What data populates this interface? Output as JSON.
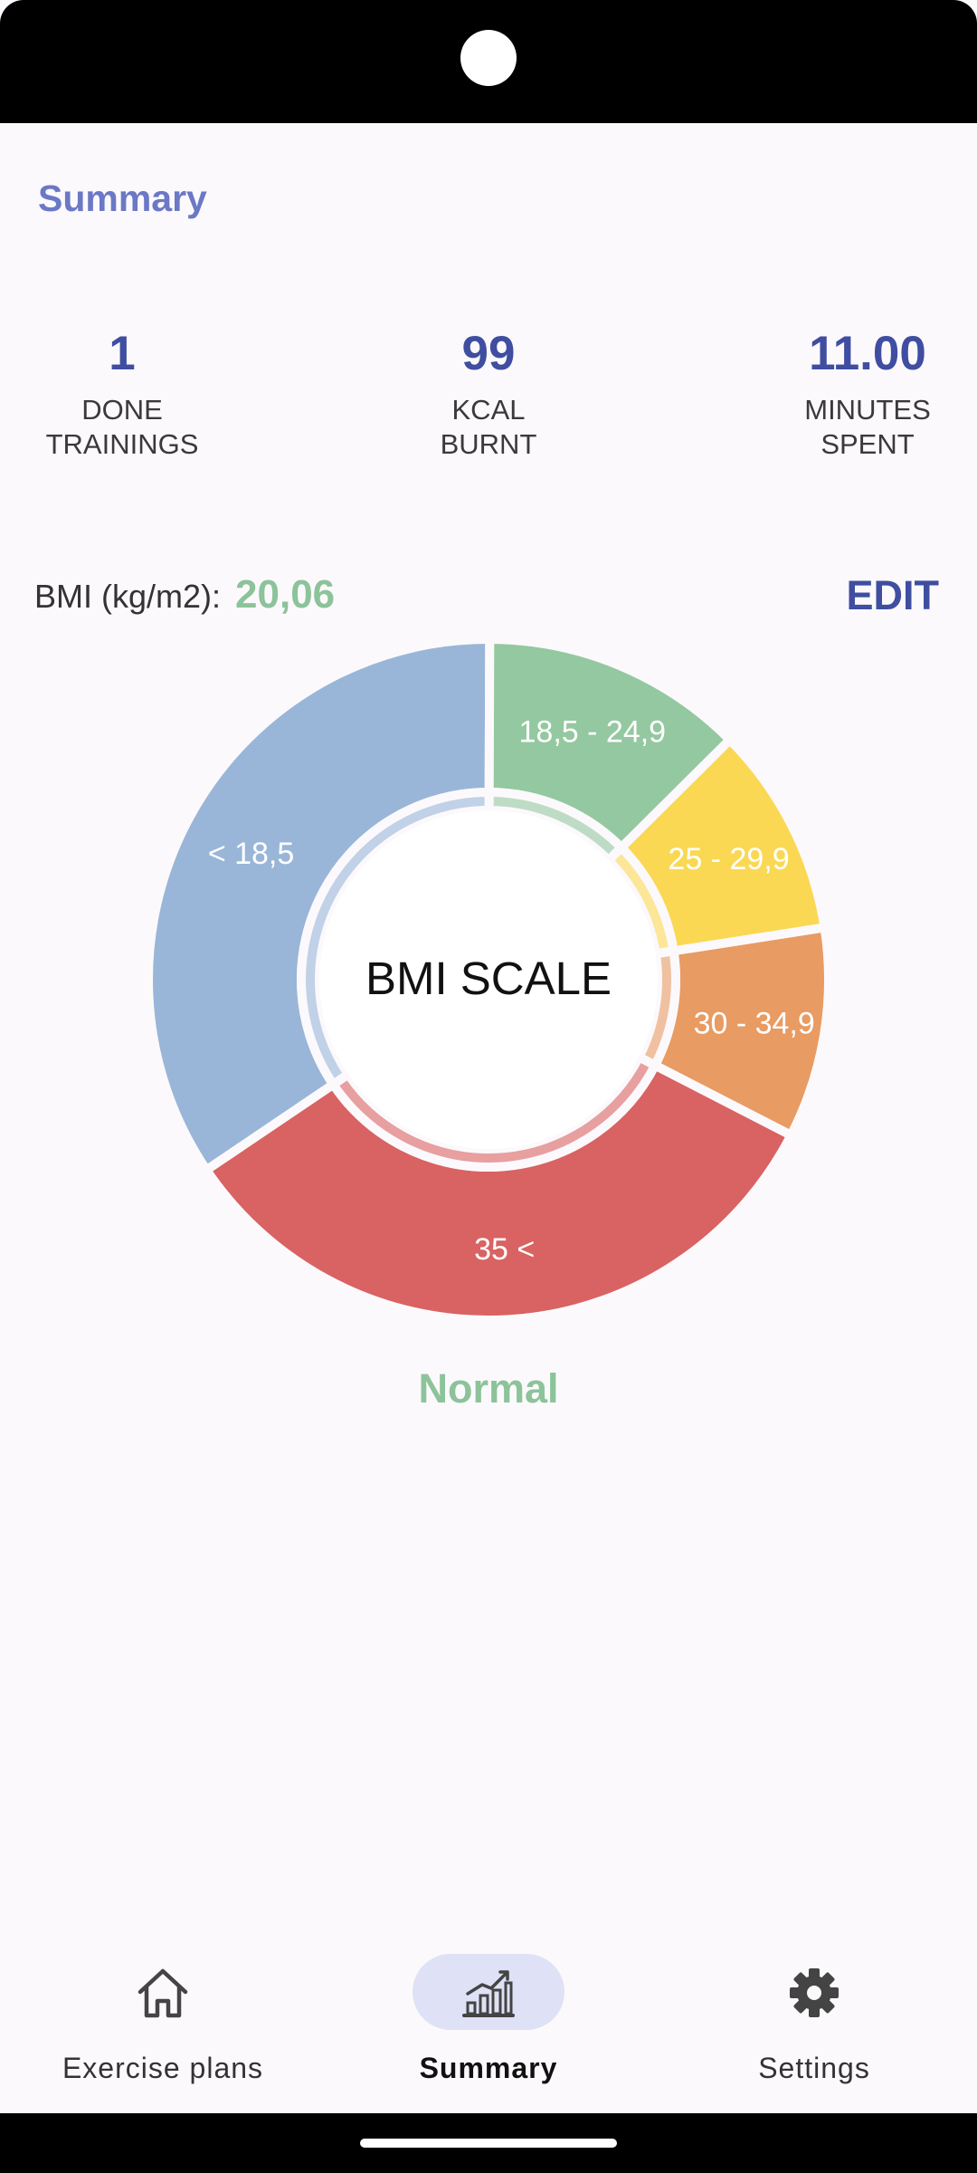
{
  "header": {
    "title": "Summary"
  },
  "stats": [
    {
      "value": "1",
      "label_line1": "DONE",
      "label_line2": "TRAININGS"
    },
    {
      "value": "99",
      "label_line1": "KCAL",
      "label_line2": "BURNT"
    },
    {
      "value": "11.00",
      "label_line1": "MINUTES",
      "label_line2": "SPENT"
    }
  ],
  "bmi": {
    "label": "BMI (kg/m2):",
    "value": "20,06",
    "edit_label": "EDIT",
    "category": "Normal",
    "category_color": "#8cc39a"
  },
  "chart_data": {
    "type": "pie",
    "title": "BMI SCALE",
    "series": [
      {
        "label": "< 18,5",
        "value": 34.5,
        "color": "#99b6d8"
      },
      {
        "label": "18,5 - 24,9",
        "value": 12.5,
        "color": "#94c8a0"
      },
      {
        "label": "25 - 29,9",
        "value": 10,
        "color": "#fbd853"
      },
      {
        "label": "30 - 34,9",
        "value": 10,
        "color": "#e89b62"
      },
      {
        "label": "35 <",
        "value": 33,
        "color": "#d96262"
      }
    ]
  },
  "nav": {
    "items": [
      {
        "label": "Exercise plans",
        "icon": "home-icon",
        "active": false
      },
      {
        "label": "Summary",
        "icon": "chart-icon",
        "active": true
      },
      {
        "label": "Settings",
        "icon": "gear-icon",
        "active": false
      }
    ]
  },
  "colors": {
    "accent": "#3f4ea0",
    "title": "#6b78c6",
    "normal": "#8cc39a"
  }
}
